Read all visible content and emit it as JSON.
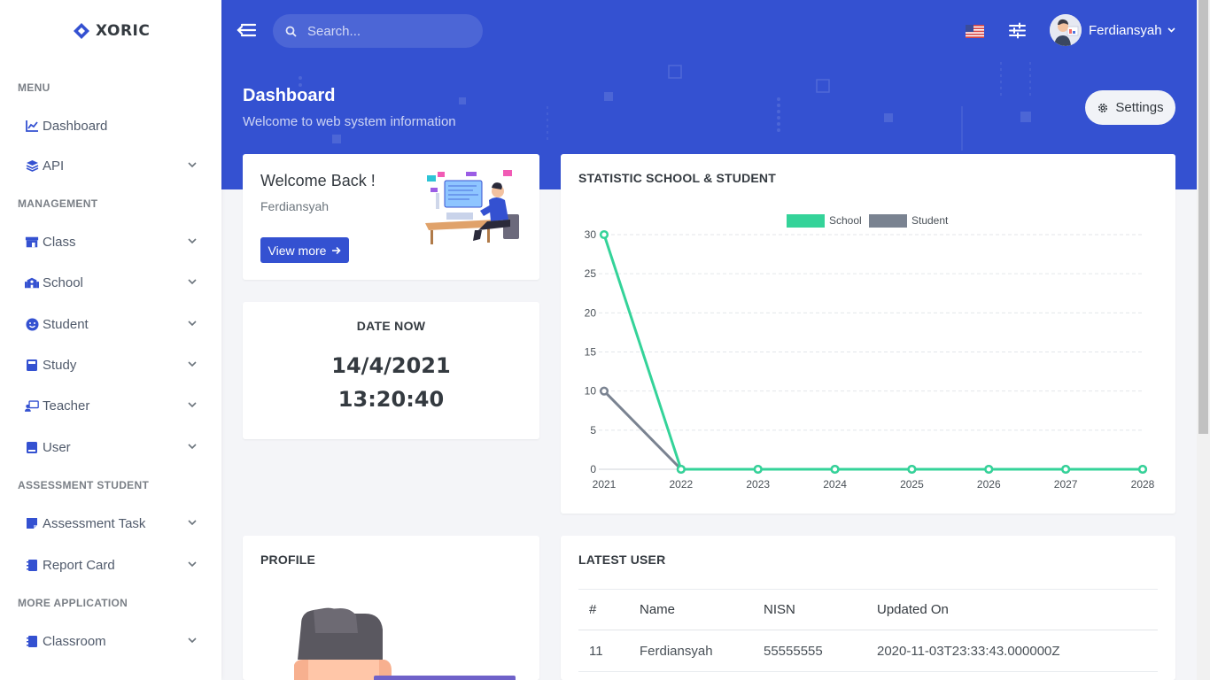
{
  "app": {
    "brand": "XORIC"
  },
  "sidebar": {
    "sections": {
      "menu": "MENU",
      "management": "MANAGEMENT",
      "assessment": "ASSESSMENT STUDENT",
      "more": "MORE APPLICATION"
    },
    "items": [
      {
        "label": "Dashboard",
        "icon": "chart-line-icon"
      },
      {
        "label": "API",
        "icon": "layers-icon"
      },
      {
        "label": "Class",
        "icon": "store-icon"
      },
      {
        "label": "School",
        "icon": "school-icon"
      },
      {
        "label": "Student",
        "icon": "smile-icon"
      },
      {
        "label": "Study",
        "icon": "book-icon"
      },
      {
        "label": "Teacher",
        "icon": "teacher-icon"
      },
      {
        "label": "User",
        "icon": "book-user-icon"
      },
      {
        "label": "Assessment Task",
        "icon": "note-icon"
      },
      {
        "label": "Report Card",
        "icon": "notebook-icon"
      },
      {
        "label": "Classroom",
        "icon": "notebook-icon"
      }
    ]
  },
  "topbar": {
    "search_placeholder": "Search...",
    "user_name": "Ferdiansyah"
  },
  "header": {
    "title": "Dashboard",
    "subtitle": "Welcome to web system information",
    "settings_label": "Settings"
  },
  "welcome": {
    "title": "Welcome Back !",
    "name": "Ferdiansyah",
    "button": "View more"
  },
  "date_card": {
    "title": "DATE NOW",
    "date": "14/4/2021",
    "time": "13:20:40"
  },
  "statistic": {
    "title": "STATISTIC SCHOOL & STUDENT"
  },
  "chart_data": {
    "type": "line",
    "title": "",
    "x": [
      "2021",
      "2022",
      "2023",
      "2024",
      "2025",
      "2026",
      "2027",
      "2028"
    ],
    "series": [
      {
        "name": "School",
        "values": [
          30,
          0,
          0,
          0,
          0,
          0,
          0,
          0
        ],
        "color": "#34d399"
      },
      {
        "name": "Student",
        "values": [
          10,
          0,
          0,
          0,
          0,
          0,
          0,
          0
        ],
        "color": "#7a8391"
      }
    ],
    "yticks": [
      0,
      5,
      10,
      15,
      20,
      25,
      30
    ],
    "ylim": [
      0,
      30
    ],
    "grid": true,
    "legend": "top-center"
  },
  "profile": {
    "title": "PROFILE"
  },
  "latest_user": {
    "title": "LATEST USER",
    "columns": [
      "#",
      "Name",
      "NISN",
      "Updated On"
    ],
    "rows": [
      [
        "11",
        "Ferdiansyah",
        "55555555",
        "2020-11-03T23:33:43.000000Z"
      ]
    ]
  },
  "colors": {
    "primary": "#3451d1",
    "school": "#34d399",
    "student": "#7a8391"
  }
}
